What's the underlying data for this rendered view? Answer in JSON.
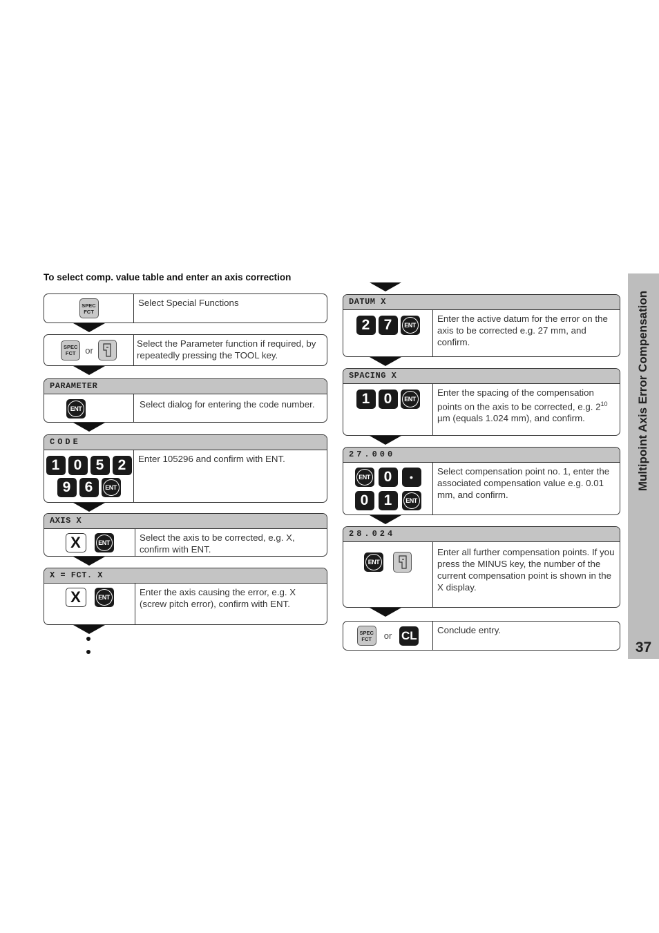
{
  "heading": "To select comp. value table and enter an axis correction",
  "sidebar": {
    "title": "Multipoint Axis Error Compensation",
    "page_number": "37"
  },
  "keys": {
    "spec_line1": "SPEC",
    "spec_line2": "FCT",
    "ent": "ENT",
    "or": "or",
    "x": "X",
    "cl": "CL",
    "dot": "•"
  },
  "left_steps": [
    {
      "header": "",
      "keys": [
        "spec-fct"
      ],
      "text": "Select Special Functions"
    },
    {
      "header": "",
      "keys": [
        "spec-fct",
        "or",
        "tool"
      ],
      "text": "Select the Parameter function if required, by repeatedly pressing the TOOL key."
    },
    {
      "header": "PARAMETER",
      "keys": [
        "ent"
      ],
      "text": "Select dialog for entering the code number."
    },
    {
      "header": "CODE",
      "keys": [
        "1",
        "0",
        "5",
        "2",
        "9",
        "6",
        "ent"
      ],
      "text": "Enter 105296 and confirm with ENT."
    },
    {
      "header": "AXIS X",
      "keys": [
        "x",
        "ent"
      ],
      "text": "Select the axis to be corrected, e.g. X, confirm with ENT."
    },
    {
      "header": "X = FCT. X",
      "keys": [
        "x",
        "ent"
      ],
      "text": "Enter the axis causing the error, e.g. X (screw pitch error), confirm with ENT."
    }
  ],
  "right_steps": [
    {
      "header": "DATUM X",
      "keys": [
        "2",
        "7",
        "ent"
      ],
      "text": "Enter the active datum for the error on the axis to be corrected e.g. 27 mm, and confirm."
    },
    {
      "header": "SPACING X",
      "keys": [
        "1",
        "0",
        "ent"
      ],
      "text_pre": "Enter the spacing of the compensation points on the axis to be corrected, e.g. 2",
      "text_sup": "10",
      "text_post": " µm (equals 1.024 mm), and confirm."
    },
    {
      "header": "27.000",
      "keys": [
        "ent",
        "0",
        "•",
        "0",
        "1",
        "ent"
      ],
      "text": "Select compensation point no. 1, enter the associated compensation value e.g. 0.01 mm, and confirm."
    },
    {
      "header": "28.024",
      "keys": [
        "ent",
        "tool"
      ],
      "text": "Enter all further compensation points. If you press the MINUS key, the number of the current compensation point is shown in the X display."
    },
    {
      "header": "",
      "keys": [
        "spec-fct",
        "or",
        "cl"
      ],
      "text": "Conclude entry."
    }
  ]
}
